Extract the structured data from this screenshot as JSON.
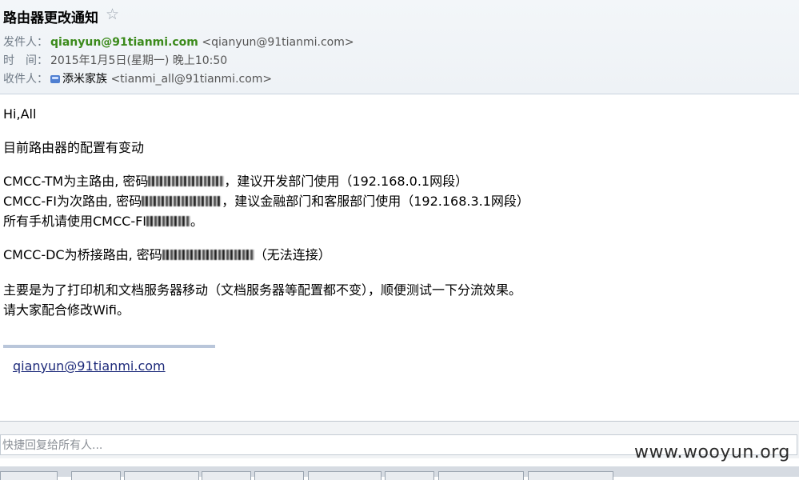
{
  "header": {
    "subject": "路由器更改通知",
    "star_icon": "☆",
    "from_label": "发件人：",
    "from_name": "qianyun@91tianmi.com",
    "from_email": "<qianyun@91tianmi.com>",
    "time_label": "时　间：",
    "time_value": "2015年1月5日(星期一) 晚上10:50",
    "to_label": "收件人：",
    "to_name": "添米家族",
    "to_email": "<tianmi_all@91tianmi.com>"
  },
  "body": {
    "greeting": "Hi,All",
    "intro": "目前路由器的配置有变动",
    "line1_a": "CMCC-TM为主路由, 密码",
    "line1_b": "建议开发部门使用（192.168.0.1网段）",
    "line2_a": "CMCC-FI为次路由, 密码",
    "line2_b": "建议金融部门和客服部门使用（192.168.3.1网段）",
    "line3_a": "所有手机请使用CMCC-FI",
    "line4_a": "CMCC-DC为桥接路由, 密码",
    "line4_b": "（无法连接）",
    "line5": "主要是为了打印机和文档服务器移动（文档服务器等配置都不变），顺便测试一下分流效果。",
    "line6": "请大家配合修改Wifi。"
  },
  "signature": {
    "link": "qianyun@91tianmi.com"
  },
  "reply": {
    "placeholder": "快捷回复给所有人..."
  },
  "watermark": "www.wooyun.org",
  "colors": {
    "sender": "#3b8a1b",
    "label": "#6f7a86",
    "link": "#1d2a7a"
  }
}
